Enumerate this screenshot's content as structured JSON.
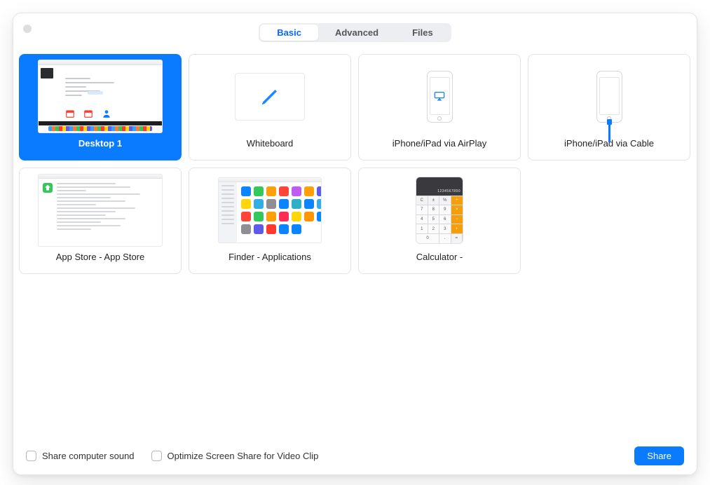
{
  "tabs": {
    "basic": "Basic",
    "advanced": "Advanced",
    "files": "Files",
    "active": "basic"
  },
  "sources": [
    {
      "id": "desktop1",
      "label": "Desktop 1",
      "selected": true
    },
    {
      "id": "whiteboard",
      "label": "Whiteboard",
      "selected": false
    },
    {
      "id": "airplay",
      "label": "iPhone/iPad via AirPlay",
      "selected": false
    },
    {
      "id": "cable",
      "label": "iPhone/iPad via Cable",
      "selected": false
    },
    {
      "id": "appstore",
      "label": "App Store - App Store",
      "selected": false
    },
    {
      "id": "finder",
      "label": "Finder - Applications",
      "selected": false
    },
    {
      "id": "calculator",
      "label": "Calculator -",
      "selected": false
    }
  ],
  "options": {
    "share_sound": {
      "label": "Share computer sound",
      "checked": false
    },
    "optimize": {
      "label": "Optimize Screen Share for Video Clip",
      "checked": false
    }
  },
  "share_button": "Share",
  "calc_keys": [
    "C",
    "±",
    "%",
    "÷",
    "7",
    "8",
    "9",
    "×",
    "4",
    "5",
    "6",
    "−",
    "1",
    "2",
    "3",
    "+",
    "0",
    ".",
    "="
  ],
  "colors": {
    "accent": "#0a7bff",
    "orange": "#f59e0b"
  }
}
